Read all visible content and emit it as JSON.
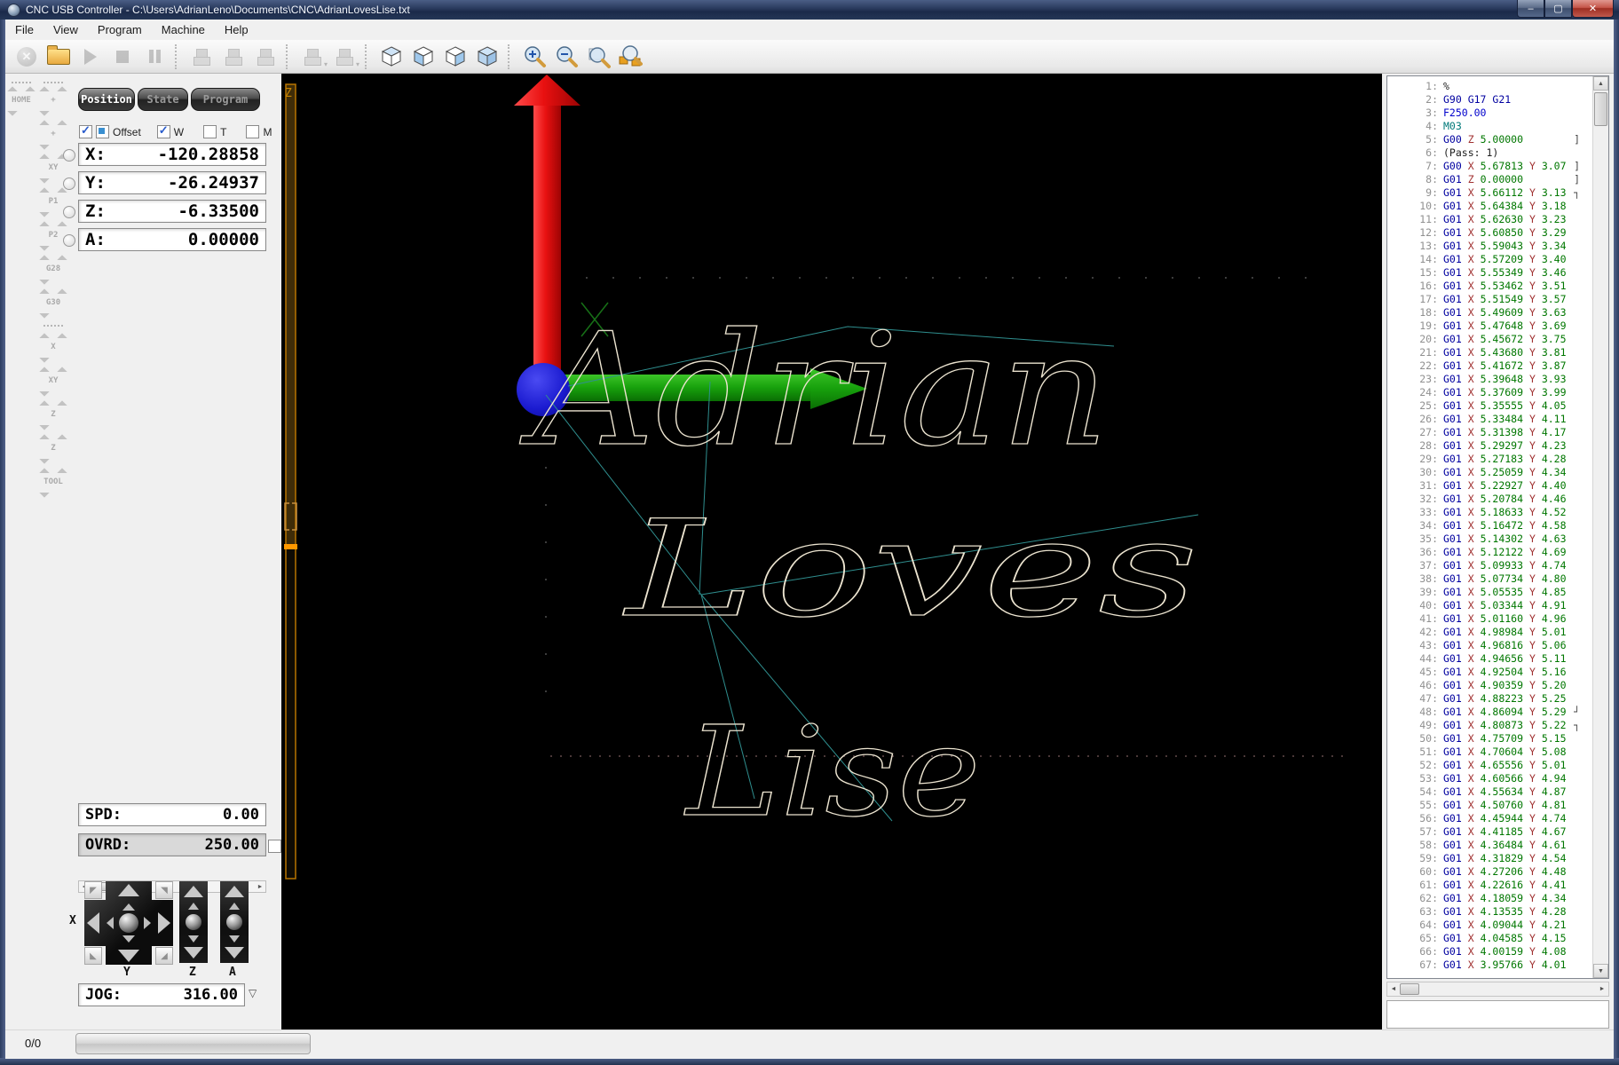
{
  "window": {
    "title": "CNC USB Controller - C:\\Users\\AdrianLeno\\Documents\\CNC\\AdrianLovesLise.txt"
  },
  "icons": {
    "minimize": "–",
    "maximize": "▢",
    "close": "✕",
    "abort": "✕",
    "dropdown": "▾",
    "scroll_up": "▲",
    "scroll_down": "▼",
    "scroll_left": "◄",
    "scroll_right": "►",
    "jog_dropdown": "▽",
    "corner_tl": "◤",
    "corner_tr": "◥",
    "corner_bl": "◣",
    "corner_br": "◢"
  },
  "menu": {
    "items": [
      "File",
      "View",
      "Program",
      "Machine",
      "Help"
    ]
  },
  "side_toolbar": {
    "home_label": "HOME",
    "buttons": [
      "+",
      "+",
      "XY",
      "P1",
      "P2",
      "G28",
      "G30",
      "|",
      "X",
      "XY",
      "Z",
      "Z",
      "TOOL"
    ]
  },
  "position_panel": {
    "tabs": [
      {
        "label": "Position",
        "active": true
      },
      {
        "label": "State",
        "active": false
      },
      {
        "label": "Program",
        "active": false
      }
    ],
    "offset_label": "Offset",
    "flags": [
      {
        "label": "W",
        "checked": true
      },
      {
        "label": "T",
        "checked": false
      },
      {
        "label": "M",
        "checked": false
      }
    ],
    "axes": [
      {
        "label": "X:",
        "value": "-120.28858"
      },
      {
        "label": "Y:",
        "value": "-26.24937"
      },
      {
        "label": "Z:",
        "value": "-6.33500"
      },
      {
        "label": "A:",
        "value": "0.00000"
      }
    ]
  },
  "jog_panel": {
    "spd_label": "SPD:",
    "spd_value": "0.00",
    "ovrd_label": "OVRD:",
    "ovrd_value": "250.00",
    "jog_label": "JOG:",
    "jog_value": "316.00",
    "axis_x": "X",
    "axis_y": "Y",
    "axis_z": "Z",
    "axis_a": "A"
  },
  "canvas": {
    "z_axis_label": "Z",
    "words": [
      "Adrian",
      "Loves",
      "Lise"
    ],
    "colors": {
      "background": "#000000",
      "x_axis_arrow": "#15a00e",
      "y_axis_arrow": "#e01010",
      "origin_marker": "#1b1bd0",
      "toolpath_stroke": "#ece4d0",
      "rapid_line": "#2f8f8f",
      "z_indicator": "#c87800"
    }
  },
  "gcode": {
    "lines": [
      "%",
      "G90 G17 G21",
      "F250.00",
      "M03",
      "G00 Z 5.00000",
      "(Pass: 1)",
      "G00 X 5.67813 Y 3.07",
      "G01 Z 0.00000",
      "G01 X 5.66112 Y 3.13",
      "G01 X 5.64384 Y 3.18",
      "G01 X 5.62630 Y 3.23",
      "G01 X 5.60850 Y 3.29",
      "G01 X 5.59043 Y 3.34",
      "G01 X 5.57209 Y 3.40",
      "G01 X 5.55349 Y 3.46",
      "G01 X 5.53462 Y 3.51",
      "G01 X 5.51549 Y 3.57",
      "G01 X 5.49609 Y 3.63",
      "G01 X 5.47648 Y 3.69",
      "G01 X 5.45672 Y 3.75",
      "G01 X 5.43680 Y 3.81",
      "G01 X 5.41672 Y 3.87",
      "G01 X 5.39648 Y 3.93",
      "G01 X 5.37609 Y 3.99",
      "G01 X 5.35555 Y 4.05",
      "G01 X 5.33484 Y 4.11",
      "G01 X 5.31398 Y 4.17",
      "G01 X 5.29297 Y 4.23",
      "G01 X 5.27183 Y 4.28",
      "G01 X 5.25059 Y 4.34",
      "G01 X 5.22927 Y 4.40",
      "G01 X 5.20784 Y 4.46",
      "G01 X 5.18633 Y 4.52",
      "G01 X 5.16472 Y 4.58",
      "G01 X 5.14302 Y 4.63",
      "G01 X 5.12122 Y 4.69",
      "G01 X 5.09933 Y 4.74",
      "G01 X 5.07734 Y 4.80",
      "G01 X 5.05535 Y 4.85",
      "G01 X 5.03344 Y 4.91",
      "G01 X 5.01160 Y 4.96",
      "G01 X 4.98984 Y 5.01",
      "G01 X 4.96816 Y 5.06",
      "G01 X 4.94656 Y 5.11",
      "G01 X 4.92504 Y 5.16",
      "G01 X 4.90359 Y 5.20",
      "G01 X 4.88223 Y 5.25",
      "G01 X 4.86094 Y 5.29",
      "G01 X 4.80873 Y 5.22",
      "G01 X 4.75709 Y 5.15",
      "G01 X 4.70604 Y 5.08",
      "G01 X 4.65556 Y 5.01",
      "G01 X 4.60566 Y 4.94",
      "G01 X 4.55634 Y 4.87",
      "G01 X 4.50760 Y 4.81",
      "G01 X 4.45944 Y 4.74",
      "G01 X 4.41185 Y 4.67",
      "G01 X 4.36484 Y 4.61",
      "G01 X 4.31829 Y 4.54",
      "G01 X 4.27206 Y 4.48",
      "G01 X 4.22616 Y 4.41",
      "G01 X 4.18059 Y 4.34",
      "G01 X 4.13535 Y 4.28",
      "G01 X 4.09044 Y 4.21",
      "G01 X 4.04585 Y 4.15",
      "G01 X 4.00159 Y 4.08",
      "G01 X 3.95766 Y 4.01"
    ],
    "marks": {
      "5": "]",
      "7": "]",
      "8": "]",
      "9": "┐",
      "48": "┘",
      "49": "┐"
    }
  },
  "statusbar": {
    "counter": "0/0"
  }
}
